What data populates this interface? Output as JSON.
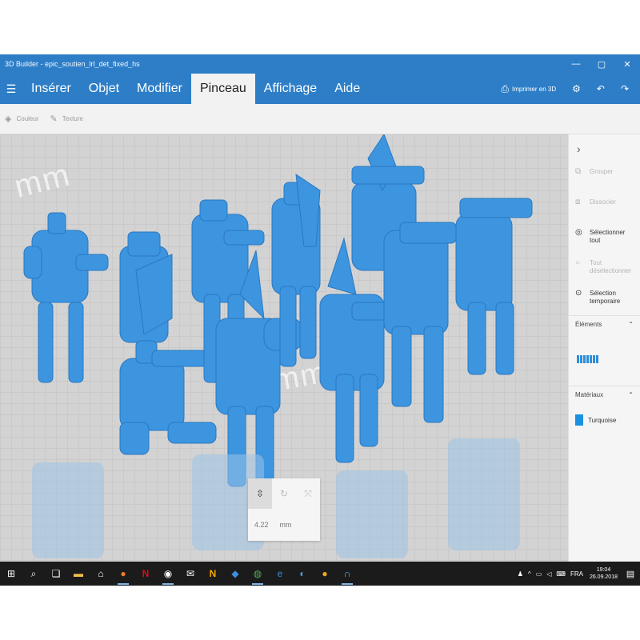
{
  "window": {
    "title": "3D Builder - epic_soutien_lrl_det_fixed_hs",
    "controls": {
      "minimize": "—",
      "maximize": "▢",
      "close": "✕"
    }
  },
  "menubar": {
    "hamburger_icon": "hamburger-icon",
    "tabs": [
      {
        "label": "Insérer",
        "active": false
      },
      {
        "label": "Objet",
        "active": false
      },
      {
        "label": "Modifier",
        "active": false
      },
      {
        "label": "Pinceau",
        "active": true
      },
      {
        "label": "Affichage",
        "active": false
      },
      {
        "label": "Aide",
        "active": false
      }
    ],
    "print_label": "Imprimer en 3D",
    "undo_icon": "undo-icon",
    "redo_icon": "redo-icon"
  },
  "subbar": {
    "tools": [
      {
        "label": "Couleur",
        "icon": "paint-bucket-icon"
      },
      {
        "label": "Texture",
        "icon": "brush-icon"
      }
    ]
  },
  "viewport": {
    "grid_label_1": "mm",
    "grid_label_2": "mm",
    "model_color": "#3d95e0",
    "measure": {
      "value": "4.22",
      "unit": "mm"
    }
  },
  "panel": {
    "actions": [
      {
        "label": "Grouper",
        "enabled": false,
        "icon": "group-icon"
      },
      {
        "label": "Dissocier",
        "enabled": false,
        "icon": "ungroup-icon"
      },
      {
        "label": "Sélectionner tout",
        "enabled": true,
        "icon": "select-all-icon"
      },
      {
        "label": "Tout désélectionner",
        "enabled": false,
        "icon": "deselect-icon"
      },
      {
        "label": "Sélection temporaire",
        "enabled": true,
        "icon": "temp-select-icon"
      }
    ],
    "elements_heading": "Éléments",
    "materials_heading": "Matériaux",
    "material_name": "Turquoise",
    "material_color": "#1e90e0"
  },
  "taskbar": {
    "language": "FRA",
    "time": "19:04",
    "date": "26.09.2018"
  }
}
